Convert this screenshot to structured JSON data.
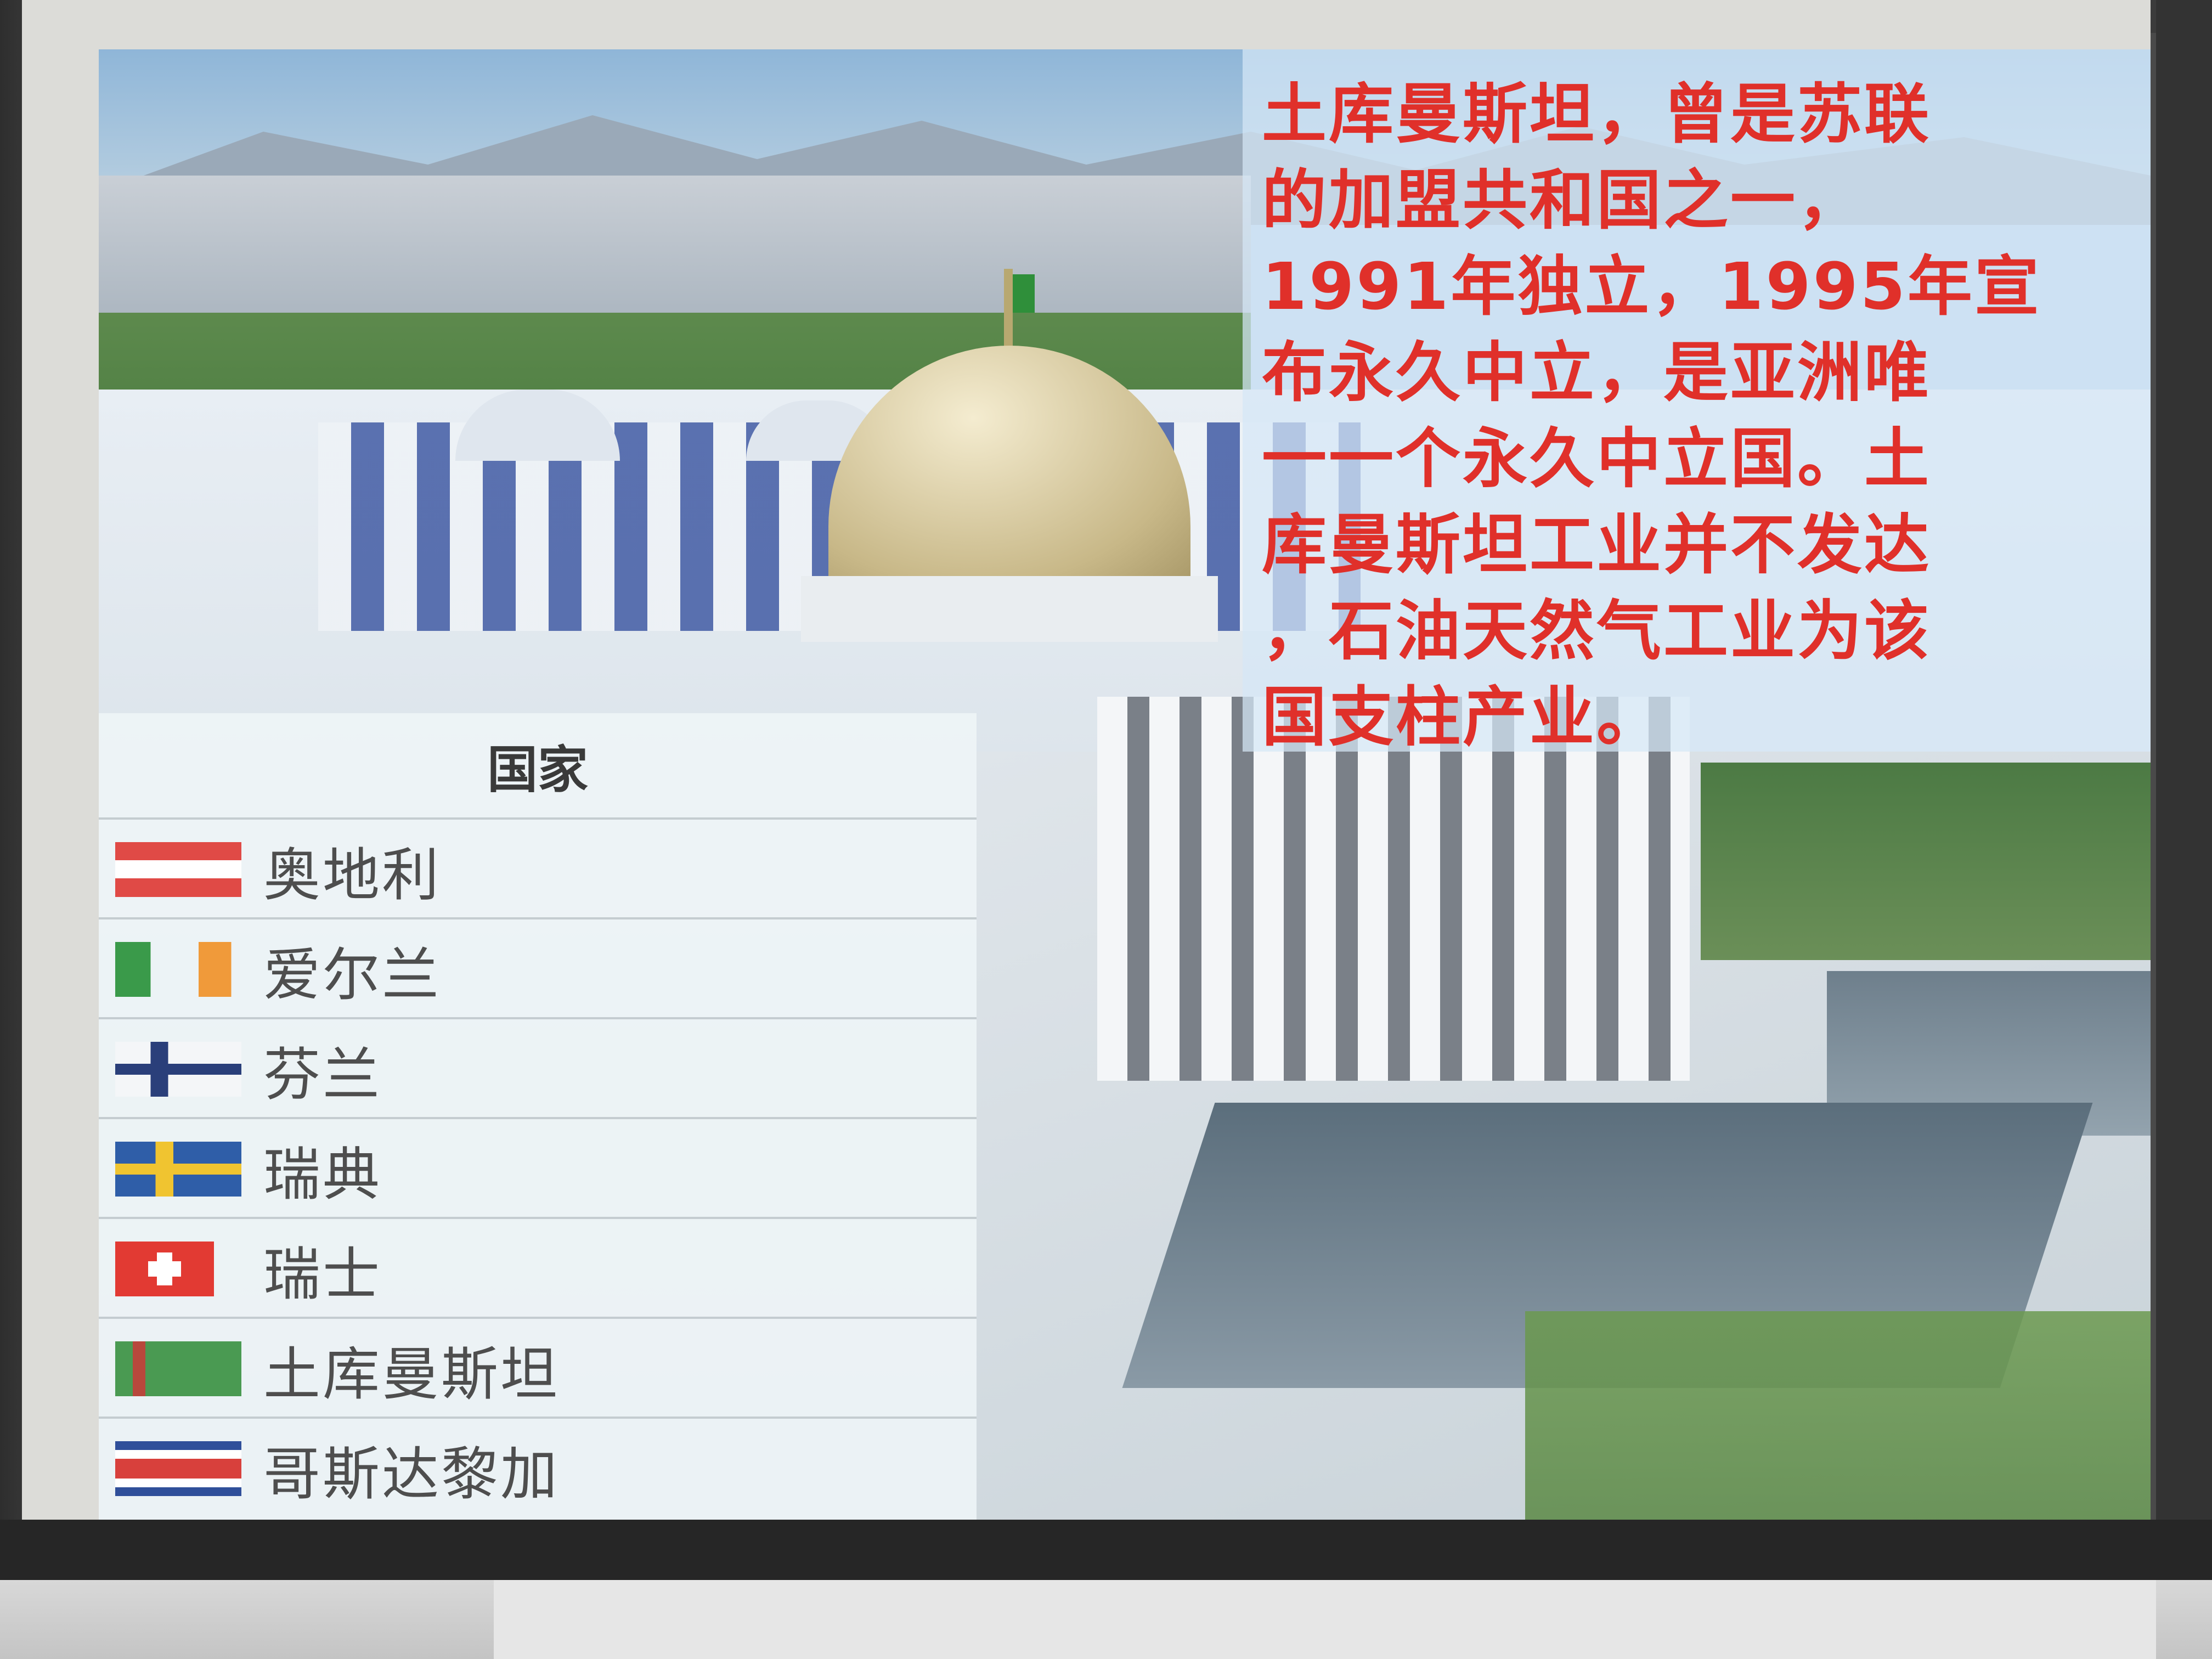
{
  "slide": {
    "paragraph_lines": [
      "土库曼斯坦，曾是苏联",
      "的加盟共和国之一，",
      "1991年独立，1995年宣",
      "布永久中立，是亚洲唯",
      "一一个永久中立国。土",
      "库曼斯坦工业并不发达",
      "，石油天然气工业为该",
      "国支柱产业。"
    ],
    "text_color": "#e0302a"
  },
  "country_table": {
    "header": "国家",
    "rows": [
      {
        "name": "奥地利",
        "flag": "austria-flag"
      },
      {
        "name": "爱尔兰",
        "flag": "ireland-flag"
      },
      {
        "name": "芬兰",
        "flag": "finland-flag"
      },
      {
        "name": "瑞典",
        "flag": "sweden-flag"
      },
      {
        "name": "瑞士",
        "flag": "switzerland-flag"
      },
      {
        "name": "土库曼斯坦",
        "flag": "turkmenistan-flag"
      },
      {
        "name": "哥斯达黎加",
        "flag": "costa-rica-flag"
      }
    ]
  }
}
